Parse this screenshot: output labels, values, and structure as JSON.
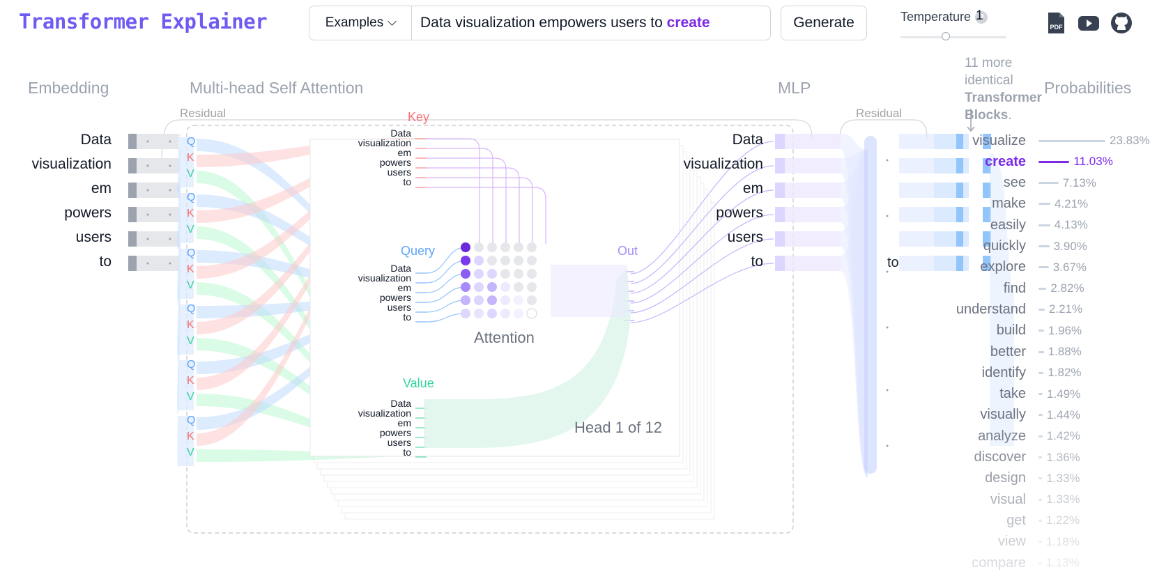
{
  "header": {
    "logo": "Transformer Explainer",
    "examples_label": "Examples",
    "prompt_prefix": "Data visualization empowers users to",
    "prompt_highlight": "create",
    "generate_label": "Generate",
    "temperature_label": "Temperature",
    "temperature_help": "?",
    "temperature_value": "1",
    "temperature_fraction": 0.43,
    "icons": [
      "pdf-icon",
      "youtube-icon",
      "github-icon"
    ]
  },
  "sections": {
    "embedding": "Embedding",
    "attention": "Multi-head Self Attention",
    "mlp": "MLP",
    "probabilities": "Probabilities",
    "residual": "Residual",
    "note_prefix": "11 more identical",
    "note_bold": "Transformer Blocks",
    "note_suffix": "."
  },
  "tokens": [
    "Data",
    "visualization",
    "em",
    "powers",
    "users",
    "to"
  ],
  "qkv_letters": [
    "Q",
    "K",
    "V"
  ],
  "attention_panel": {
    "key_label": "Key",
    "query_label": "Query",
    "value_label": "Value",
    "out_label": "Out",
    "attention_label": "Attention",
    "head_label": "Head 1 of 12"
  },
  "mlp_token": "to",
  "probabilities": [
    {
      "word": "visualize",
      "pct": "23.83%",
      "value": 23.83
    },
    {
      "word": "create",
      "pct": "11.03%",
      "value": 11.03,
      "selected": true
    },
    {
      "word": "see",
      "pct": "7.13%",
      "value": 7.13
    },
    {
      "word": "make",
      "pct": "4.21%",
      "value": 4.21
    },
    {
      "word": "easily",
      "pct": "4.13%",
      "value": 4.13
    },
    {
      "word": "quickly",
      "pct": "3.90%",
      "value": 3.9
    },
    {
      "word": "explore",
      "pct": "3.67%",
      "value": 3.67
    },
    {
      "word": "find",
      "pct": "2.82%",
      "value": 2.82
    },
    {
      "word": "understand",
      "pct": "2.21%",
      "value": 2.21
    },
    {
      "word": "build",
      "pct": "1.96%",
      "value": 1.96
    },
    {
      "word": "better",
      "pct": "1.88%",
      "value": 1.88
    },
    {
      "word": "identify",
      "pct": "1.82%",
      "value": 1.82
    },
    {
      "word": "take",
      "pct": "1.49%",
      "value": 1.49
    },
    {
      "word": "visually",
      "pct": "1.44%",
      "value": 1.44
    },
    {
      "word": "analyze",
      "pct": "1.42%",
      "value": 1.42
    },
    {
      "word": "discover",
      "pct": "1.36%",
      "value": 1.36
    },
    {
      "word": "design",
      "pct": "1.33%",
      "value": 1.33
    },
    {
      "word": "visual",
      "pct": "1.33%",
      "value": 1.33
    },
    {
      "word": "get",
      "pct": "1.22%",
      "value": 1.22
    },
    {
      "word": "view",
      "pct": "1.18%",
      "value": 1.18
    },
    {
      "word": "compare",
      "pct": "1.13%",
      "value": 1.13
    }
  ],
  "colors": {
    "accent": "#7c2ae8",
    "query": "#60a5fa",
    "key": "#f87171",
    "value": "#34d399",
    "out": "#a78bfa"
  }
}
